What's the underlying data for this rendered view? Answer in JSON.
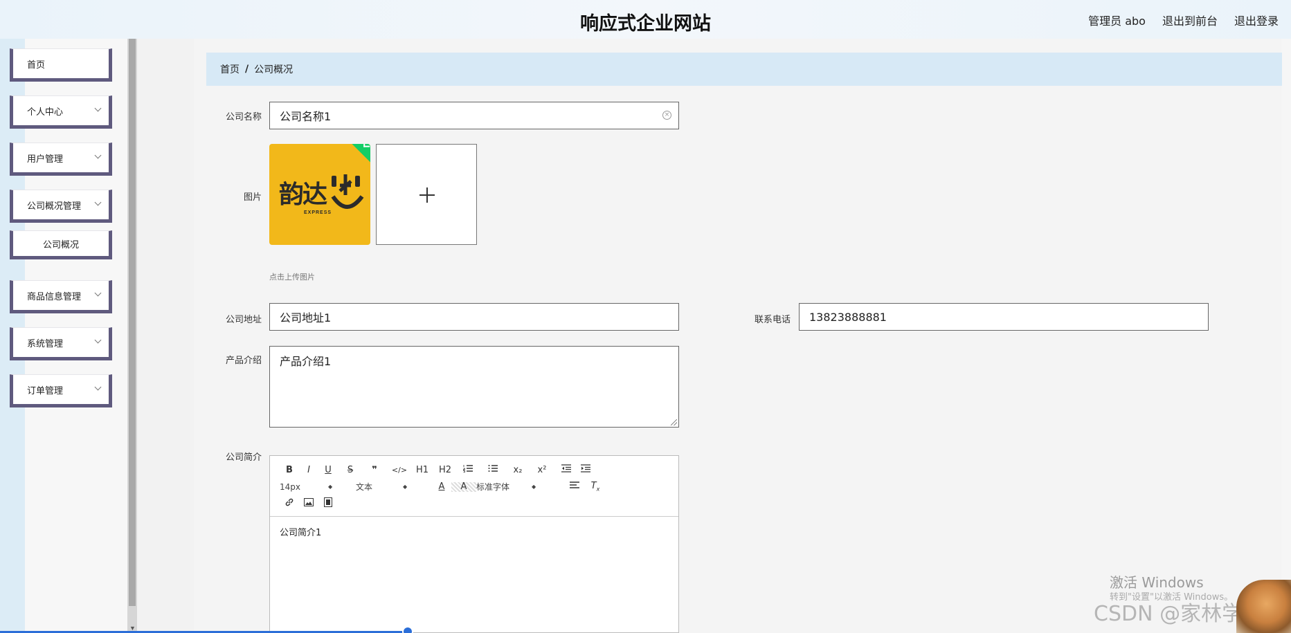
{
  "header": {
    "title": "响应式企业网站",
    "links": [
      "管理员 abo",
      "退出到前台",
      "退出登录"
    ]
  },
  "sidebar": {
    "items": [
      {
        "label": "首页",
        "expandable": false
      },
      {
        "label": "个人中心",
        "expandable": true
      },
      {
        "label": "用户管理",
        "expandable": true
      },
      {
        "label": "公司概况管理",
        "expandable": true
      },
      {
        "label": "公司概况",
        "expandable": false,
        "sub": true
      },
      {
        "label": "商品信息管理",
        "expandable": true
      },
      {
        "label": "系统管理",
        "expandable": true
      },
      {
        "label": "订单管理",
        "expandable": true
      }
    ]
  },
  "breadcrumb": {
    "items": [
      "首页",
      "公司概况"
    ],
    "separator": "/"
  },
  "form": {
    "company_name": {
      "label": "公司名称",
      "value": "公司名称1"
    },
    "image": {
      "label": "图片",
      "upload_tip": "点击上传图片",
      "thumb_logo_text": "韵达",
      "thumb_logo_sub": "EXPRESS"
    },
    "address": {
      "label": "公司地址",
      "value": "公司地址1"
    },
    "phone": {
      "label": "联系电话",
      "value": "13823888881"
    },
    "product_intro": {
      "label": "产品介绍",
      "value": "产品介绍1"
    },
    "company_brief": {
      "label": "公司简介",
      "content": "公司简介1",
      "toolbar": {
        "row1": [
          "B",
          "I",
          "U",
          "S",
          "❞",
          "</>",
          "H1",
          "H2",
          "ordered-list",
          "bullet-list",
          "x₂",
          "x²",
          "outdent",
          "indent"
        ],
        "font_size": "14px",
        "paragraph": "文本",
        "font_family": "标准字体"
      }
    }
  },
  "watermark": {
    "activate": "激活 Windows",
    "activate_sub": "转到\"设置\"以激活 Windows。",
    "csdn": "CSDN @家林学长"
  },
  "colors": {
    "sidebar_border": "#5f5a7e",
    "breadcrumb_bg": "#d7e9f6",
    "upload_check": "#13ce66",
    "logo_bg": "#f2b81a"
  }
}
